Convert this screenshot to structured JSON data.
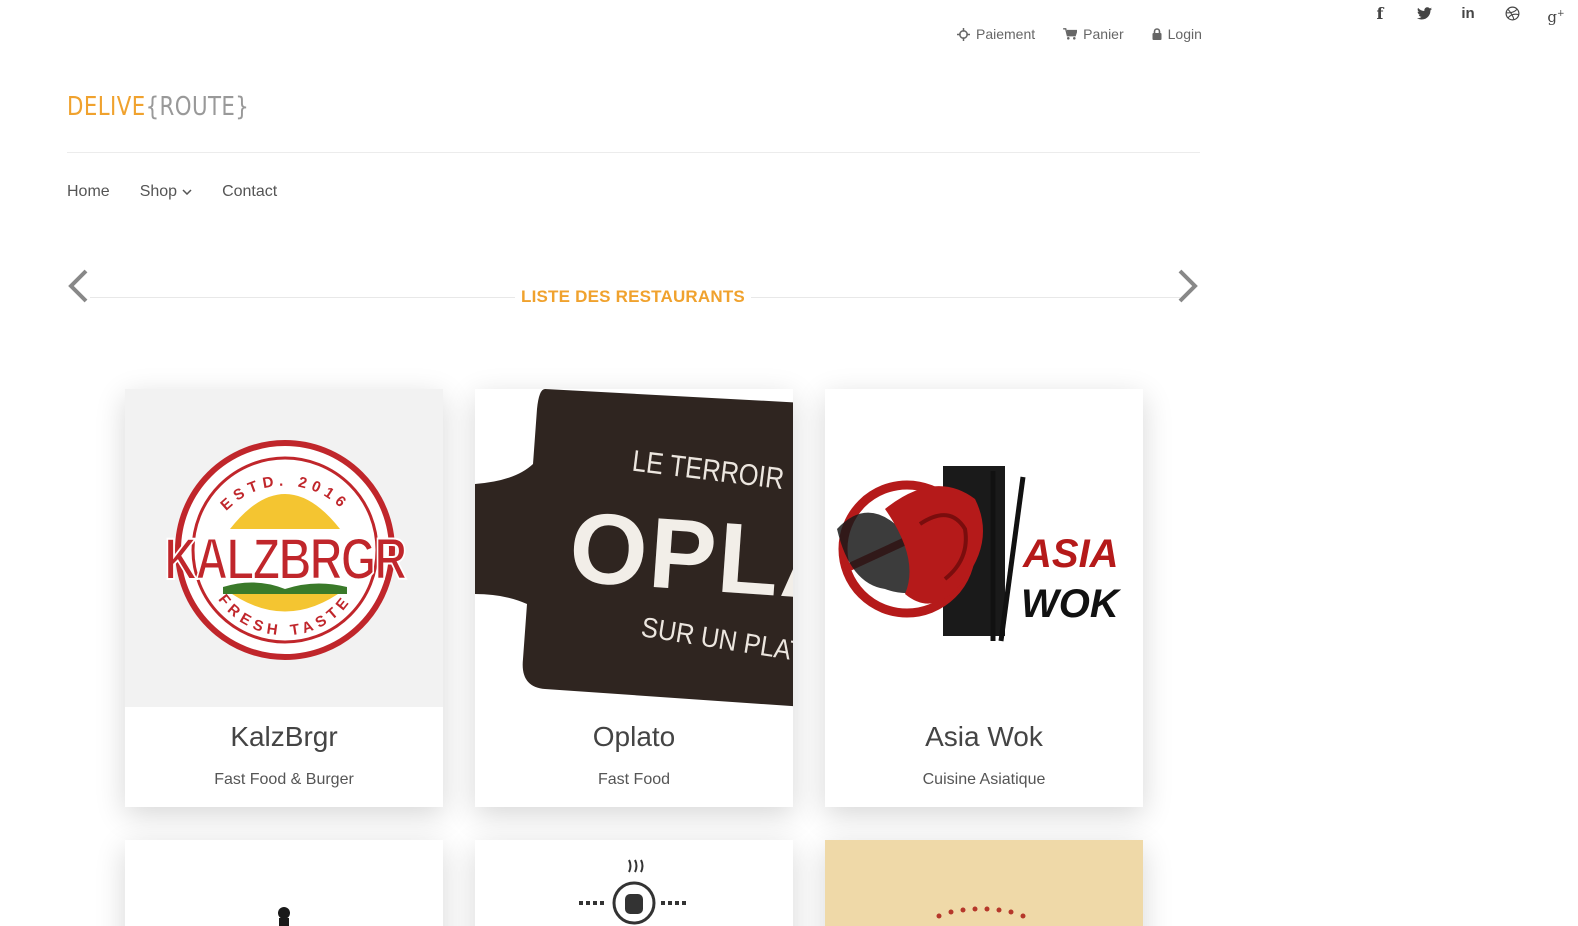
{
  "social": {
    "icons": [
      "facebook-icon",
      "twitter-icon",
      "linkedin-icon",
      "dribbble-icon",
      "google-plus-icon"
    ]
  },
  "toplinks": {
    "payment": "Paiement",
    "cart": "Panier",
    "login": "Login"
  },
  "logo": {
    "part1": "DELIVE",
    "part2": "{ROUTE}"
  },
  "nav": {
    "home": "Home",
    "shop": "Shop",
    "contact": "Contact"
  },
  "section": {
    "title": "LISTE DES RESTAURANTS"
  },
  "restaurants": [
    {
      "name": "KalzBrgr",
      "category": "Fast Food & Burger",
      "logo_top": "ESTD. 2016",
      "logo_main": "KALZBRGR",
      "logo_bottom": "FRESH TASTE"
    },
    {
      "name": "Oplato",
      "category": "Fast Food",
      "logo_top": "LE TERROIR",
      "logo_main": "OPLAT",
      "logo_bottom": "SUR UN PLATO"
    },
    {
      "name": "Asia Wok",
      "category": "Cuisine Asiatique",
      "logo_line1": "ASIA",
      "logo_line2": "WOK"
    }
  ],
  "colors": {
    "accent": "#f0a22e",
    "burger_red": "#c0262b",
    "oplato_board": "#2f2520",
    "asia_red": "#b51a1a",
    "card_tan": "#efd9a8"
  }
}
